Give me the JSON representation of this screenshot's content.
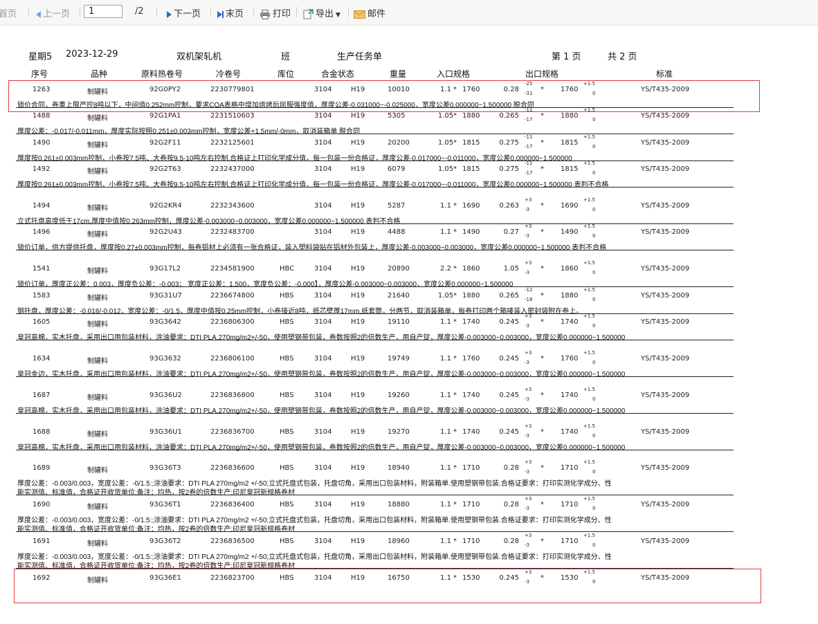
{
  "toolbar": {
    "first": "首页",
    "prev": "上一页",
    "page_value": "1",
    "page_total": "/2",
    "next": "下一页",
    "last": "末页",
    "print": "打印",
    "export": "导出",
    "mail": "邮件"
  },
  "report": {
    "weekday": "星期5",
    "date": "2023-12-29",
    "mill": "双机架轧机",
    "shift": "班",
    "title": "生产任务单",
    "page_no": "第 1 页",
    "page_count": "共 2 页"
  },
  "columns": [
    "序号",
    "品种",
    "原料热卷号",
    "冷卷号",
    "库位",
    "合金状态",
    "重量",
    "入口规格",
    "出口规格",
    "标准"
  ],
  "rows": [
    {
      "seq": "1263",
      "variety": "制罐料",
      "raw": "92G0PY2",
      "cold": "2230779801",
      "loc": "",
      "alloy": "3104",
      "temper": "H19",
      "weight": "10010",
      "in_t": "1.1",
      "in_w": "1760",
      "out_t": "0.28",
      "tol_up": "-25",
      "tol_dn": "-31",
      "out_w": "1760",
      "w_up": "+1.5",
      "w_dn": "0",
      "std": "YS/T435-2009",
      "note": [
        "锁价合同，卷重上限严控8吨以下，中间值0.252mm控制，要求COA表格中增加烘烤后屈服强度值，厚度公差-0.031000~-0.025000，宽度公差0.000000~1.500000 脱合同"
      ]
    },
    {
      "seq": "1488",
      "variety": "制罐料",
      "raw": "92G1PA1",
      "cold": "2231510603",
      "loc": "",
      "alloy": "3104",
      "temper": "H19",
      "weight": "5305",
      "in_t": "1.05",
      "in_w": "1880",
      "out_t": "0.265",
      "tol_up": "-11",
      "tol_dn": "-17",
      "out_w": "1880",
      "w_up": "+1.5",
      "w_dn": "0",
      "std": "YS/T435-2009",
      "note": [
        "厚度公差：-0.017/-0.011mm，厚度实际按照0.251±0.003mm控制，宽度公差+1.5mm/-0mm，取消装箱单 脱合同"
      ]
    },
    {
      "seq": "1490",
      "variety": "制罐料",
      "raw": "92G2F11",
      "cold": "2232125601",
      "loc": "",
      "alloy": "3104",
      "temper": "H19",
      "weight": "20200",
      "in_t": "1.05",
      "in_w": "1815",
      "out_t": "0.275",
      "tol_up": "-11",
      "tol_dn": "-17",
      "out_w": "1815",
      "w_up": "+1.5",
      "w_dn": "0",
      "std": "YS/T435-2009",
      "note": [
        "厚度按0.261±0.003mm控制，小卷按7.5吨、大卷按9.5-10吨左右控制.合格证上打印化学成分值，每一包装一份合格证，厚度公差-0.017000~-0.011000，宽度公差0.000000~1.500000"
      ]
    },
    {
      "seq": "1492",
      "variety": "制罐料",
      "raw": "92G2T63",
      "cold": "2232437000",
      "loc": "",
      "alloy": "3104",
      "temper": "H19",
      "weight": "6079",
      "in_t": "1.05",
      "in_w": "1815",
      "out_t": "0.275",
      "tol_up": "-11",
      "tol_dn": "-17",
      "out_w": "1815",
      "w_up": "+1.5",
      "w_dn": "0",
      "std": "YS/T435-2009",
      "note": [
        "厚度按0.261±0.003mm控制，小卷按7.5吨、大卷按9.5-10吨左右控制.合格证上打印化学成分值，每一包装一份合格证，厚度公差-0.017000~-0.011000，宽度公差0.000000~1.500000 表判不合格"
      ]
    },
    {
      "seq": "1494",
      "variety": "制罐料",
      "raw": "92G2KR4",
      "cold": "2232343600",
      "loc": "",
      "alloy": "3104",
      "temper": "H19",
      "weight": "5287",
      "in_t": "1.1",
      "in_w": "1690",
      "out_t": "0.263",
      "tol_up": "+3",
      "tol_dn": "-3",
      "out_w": "1690",
      "w_up": "+1.5",
      "w_dn": "0",
      "std": "YS/T435-2009",
      "note": [
        "立式托盘高度低于17cm,厚度中值按0.263mm控制，厚度公差-0.003000~0.003000，宽度公差0.000000~1.500000 表判不合格"
      ]
    },
    {
      "seq": "1496",
      "variety": "制罐料",
      "raw": "92G2U43",
      "cold": "2232483700",
      "loc": "",
      "alloy": "3104",
      "temper": "H19",
      "weight": "4488",
      "in_t": "1.1",
      "in_w": "1490",
      "out_t": "0.27",
      "tol_up": "+3",
      "tol_dn": "-3",
      "out_w": "1490",
      "w_up": "+1.5",
      "w_dn": "0",
      "std": "YS/T435-2009",
      "note": [
        "锁价订单，供方提供托盘，厚度按0.27±0.003mm控制，每卷铝材上必须有一张合格证，装入塑料袋贴在铝材外包装上，厚度公差-0.003000~0.003000，宽度公差0.000000~1.500000 表判不合格"
      ]
    },
    {
      "seq": "1541",
      "variety": "制罐料",
      "raw": "93G17L2",
      "cold": "2234581900",
      "loc": "HBC",
      "alloy": "3104",
      "temper": "H19",
      "weight": "20890",
      "in_t": "2.2",
      "in_w": "1860",
      "out_t": "1.05",
      "tol_up": "+3",
      "tol_dn": "-3",
      "out_w": "1860",
      "w_up": "+1.5",
      "w_dn": "0",
      "std": "YS/T435-2009",
      "note": [
        "锁价订单，厚度正公差：0.003，厚度负公差：-0.003； 宽度正公差：1.500，宽度负公差：-0.000】，厚度公差-0.003000~0.003000，宽度公差0.000000~1.500000"
      ]
    },
    {
      "seq": "1583",
      "variety": "制罐料",
      "raw": "93G31U7",
      "cold": "2236674800",
      "loc": "HBS",
      "alloy": "3104",
      "temper": "H19",
      "weight": "21640",
      "in_t": "1.05",
      "in_w": "1880",
      "out_t": "0.265",
      "tol_up": "-12",
      "tol_dn": "-18",
      "out_w": "1880",
      "w_up": "+1.5",
      "w_dn": "0",
      "std": "YS/T435-2009",
      "note": [
        "钢托盘，厚度公差：-0.018/-0.012，宽度公差：-0/1.5，厚度中值按0.25mm控制，小卷接近8吨，纸芯壁厚17mm,纸套筒，分两节，取消装箱单，每卷打印两个箱唛装入密封袋附在卷上。"
      ]
    },
    {
      "seq": "1605",
      "variety": "制罐料",
      "raw": "93G3642",
      "cold": "2236806300",
      "loc": "HBS",
      "alloy": "3104",
      "temper": "H19",
      "weight": "19110",
      "in_t": "1.1",
      "in_w": "1740",
      "out_t": "0.245",
      "tol_up": "+3",
      "tol_dn": "-3",
      "out_w": "1740",
      "w_up": "+1.5",
      "w_dn": "0",
      "std": "YS/T435-2009",
      "note": [
        "皇冠高棉，实木托盘，采用出口用包装材料，涂油要求：DTI PLA,270mg/m2+/-50，使用塑钢带包装，卷数按照2的倍数生产，用自产锭，厚度公差-0.003000~0.003000，宽度公差0.000000~1.500000"
      ]
    },
    {
      "seq": "1634",
      "variety": "制罐料",
      "raw": "93G3632",
      "cold": "2236806100",
      "loc": "HBS",
      "alloy": "3104",
      "temper": "H19",
      "weight": "19749",
      "in_t": "1.1",
      "in_w": "1760",
      "out_t": "0.245",
      "tol_up": "+3",
      "tol_dn": "-3",
      "out_w": "1760",
      "w_up": "+1.5",
      "w_dn": "0",
      "std": "YS/T435-2009",
      "note": [
        "皇冠金边，实木托盘，采用出口用包装材料，涂油要求：DTI PLA,270mg/m2+/-50，使用塑钢带包装，卷数按照2的倍数生产，用自产锭，厚度公差-0.003000~0.003000，宽度公差0.000000~1.500000"
      ]
    },
    {
      "seq": "1687",
      "variety": "制罐料",
      "raw": "93G36U2",
      "cold": "2236836800",
      "loc": "HBS",
      "alloy": "3104",
      "temper": "H19",
      "weight": "19260",
      "in_t": "1.1",
      "in_w": "1740",
      "out_t": "0.245",
      "tol_up": "+3",
      "tol_dn": "-3",
      "out_w": "1740",
      "w_up": "+1.5",
      "w_dn": "0",
      "std": "YS/T435-2009",
      "note": [
        "皇冠高棉，实木托盘，采用出口用包装材料，涂油要求：DTI PLA,270mg/m2+/-50，使用塑钢带包装，卷数按照2的倍数生产，用自产锭，厚度公差-0.003000~0.003000，宽度公差0.000000~1.500000"
      ]
    },
    {
      "seq": "1688",
      "variety": "制罐料",
      "raw": "93G36U1",
      "cold": "2236836700",
      "loc": "HBS",
      "alloy": "3104",
      "temper": "H19",
      "weight": "19270",
      "in_t": "1.1",
      "in_w": "1740",
      "out_t": "0.245",
      "tol_up": "+3",
      "tol_dn": "-3",
      "out_w": "1740",
      "w_up": "+1.5",
      "w_dn": "0",
      "std": "YS/T435-2009",
      "note": [
        "皇冠高棉，实木托盘，采用出口用包装材料，涂油要求：DTI PLA,270mg/m2+/-50，使用塑钢带包装，卷数按照2的倍数生产，用自产锭，厚度公差-0.003000~0.003000，宽度公差0.000000~1.500000"
      ]
    },
    {
      "seq": "1689",
      "variety": "制罐料",
      "raw": "93G36T3",
      "cold": "2236836600",
      "loc": "HBS",
      "alloy": "3104",
      "temper": "H19",
      "weight": "18940",
      "in_t": "1.1",
      "in_w": "1710",
      "out_t": "0.28",
      "tol_up": "+3",
      "tol_dn": "-3",
      "out_w": "1710",
      "w_up": "+1.5",
      "w_dn": "0",
      "std": "YS/T435-2009",
      "note": [
        "厚度公差：-0.003/0.003，宽度公差：-0/1.5:;涂油要求：DTI PLA 270mg/m2 +/-50;立式托盘式包装，托盘切角，采用出口包装材料，附装箱单.使用塑钢带包装.合格证要求：打印实测化学成分、性",
        "能实测值、标准值，合格证开收货单位:备注：均热，按2卷的倍数生产:印尼皇冠新规格卷材"
      ]
    },
    {
      "seq": "1690",
      "variety": "制罐料",
      "raw": "93G36T1",
      "cold": "2236836400",
      "loc": "HBS",
      "alloy": "3104",
      "temper": "H19",
      "weight": "18880",
      "in_t": "1.1",
      "in_w": "1710",
      "out_t": "0.28",
      "tol_up": "+3",
      "tol_dn": "-3",
      "out_w": "1710",
      "w_up": "+1.5",
      "w_dn": "0",
      "std": "YS/T435-2009",
      "note": [
        "厚度公差：-0.003/0.003，宽度公差：-0/1.5:;涂油要求：DTI PLA 270mg/m2 +/-50;立式托盘式包装，托盘切角，采用出口包装材料，附装箱单.使用塑钢带包装.合格证要求：打印实测化学成分、性",
        "能实测值、标准值，合格证开收货单位:备注：均热，按2卷的倍数生产:印尼皇冠新规格卷材"
      ]
    },
    {
      "seq": "1691",
      "variety": "制罐料",
      "raw": "93G36T2",
      "cold": "2236836500",
      "loc": "HBS",
      "alloy": "3104",
      "temper": "H19",
      "weight": "18960",
      "in_t": "1.1",
      "in_w": "1710",
      "out_t": "0.28",
      "tol_up": "+3",
      "tol_dn": "-3",
      "out_w": "1710",
      "w_up": "+1.5",
      "w_dn": "0",
      "std": "YS/T435-2009",
      "note": [
        "厚度公差：-0.003/0.003，宽度公差：-0/1.5:;涂油要求：DTI PLA 270mg/m2 +/-50;立式托盘式包装，托盘切角，采用出口包装材料，附装箱单.使用塑钢带包装.合格证要求：打印实测化学成分、性",
        "能实测值、标准值，合格证开收货单位:备注：均热，按2卷的倍数生产:印尼皇冠新规格卷材"
      ]
    },
    {
      "seq": "1692",
      "variety": "制罐料",
      "raw": "93G36E1",
      "cold": "2236823700",
      "loc": "HBS",
      "alloy": "3104",
      "temper": "H19",
      "weight": "16750",
      "in_t": "1.1",
      "in_w": "1530",
      "out_t": "0.245",
      "tol_up": "+3",
      "tol_dn": "-3",
      "out_w": "1530",
      "w_up": "+1.5",
      "w_dn": "0",
      "std": "YS/T435-2009",
      "note": []
    }
  ]
}
